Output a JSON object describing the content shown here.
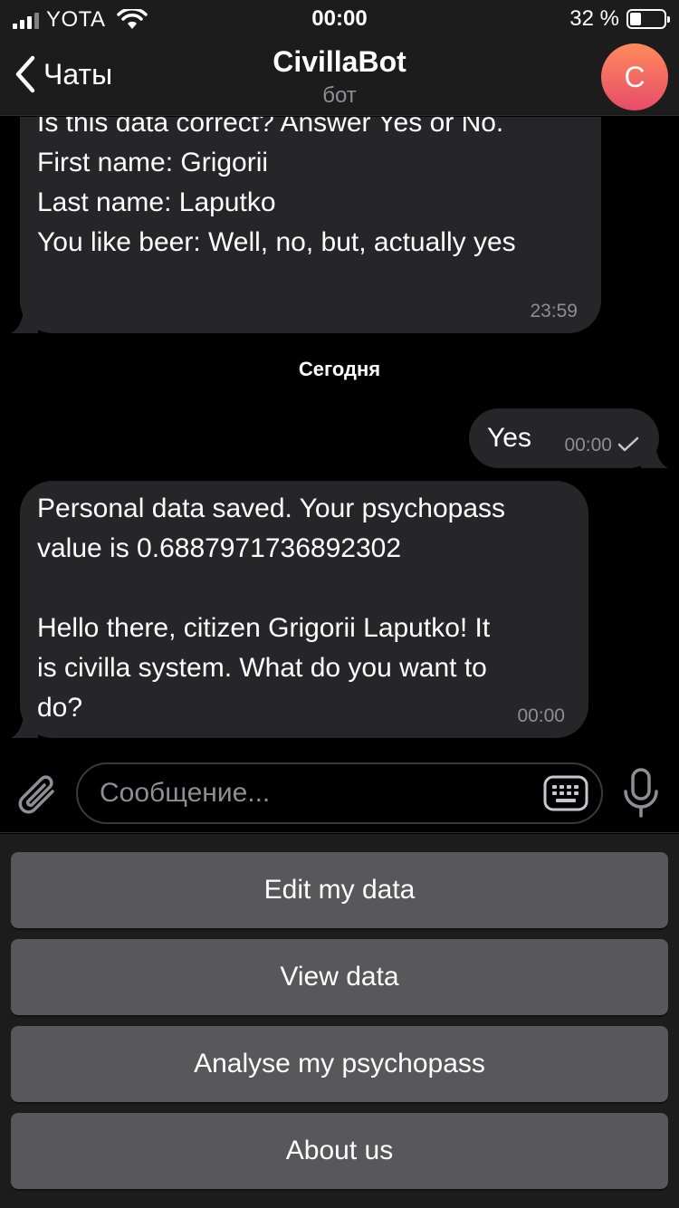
{
  "status_bar": {
    "carrier": "YOTA",
    "time": "00:00",
    "battery": "32 %"
  },
  "nav": {
    "back_label": "Чаты",
    "title": "CivillaBot",
    "subtitle": "бот",
    "avatar_letter": "C"
  },
  "messages": [
    {
      "direction": "incoming",
      "text": "Is this data correct? Answer Yes or No.\nFirst name: Grigorii\nLast name: Laputko\nYou like beer: Well, no, but, actually yes",
      "time": "23:59"
    },
    {
      "direction": "outgoing",
      "text": "Yes",
      "time": "00:00",
      "status": "sent"
    },
    {
      "direction": "incoming",
      "text": "Personal data saved. Your psychopass\nvalue is 0.6887971736892302\n\nHello there, citizen Grigorii Laputko! It\nis civilla system. What do you want to\ndo?",
      "time": "00:00"
    }
  ],
  "date_separator": "Сегодня",
  "composer": {
    "placeholder": "Сообщение..."
  },
  "keyboard_buttons": [
    {
      "label": "Edit my data"
    },
    {
      "label": "View data"
    },
    {
      "label": "Analyse my psychopass"
    },
    {
      "label": "About us"
    }
  ],
  "colors": {
    "avatar_gradient_top": "#ff8a5c",
    "avatar_gradient_bottom": "#e74c6a",
    "bubble": "#262628",
    "keyboard_button": "#58585a"
  }
}
